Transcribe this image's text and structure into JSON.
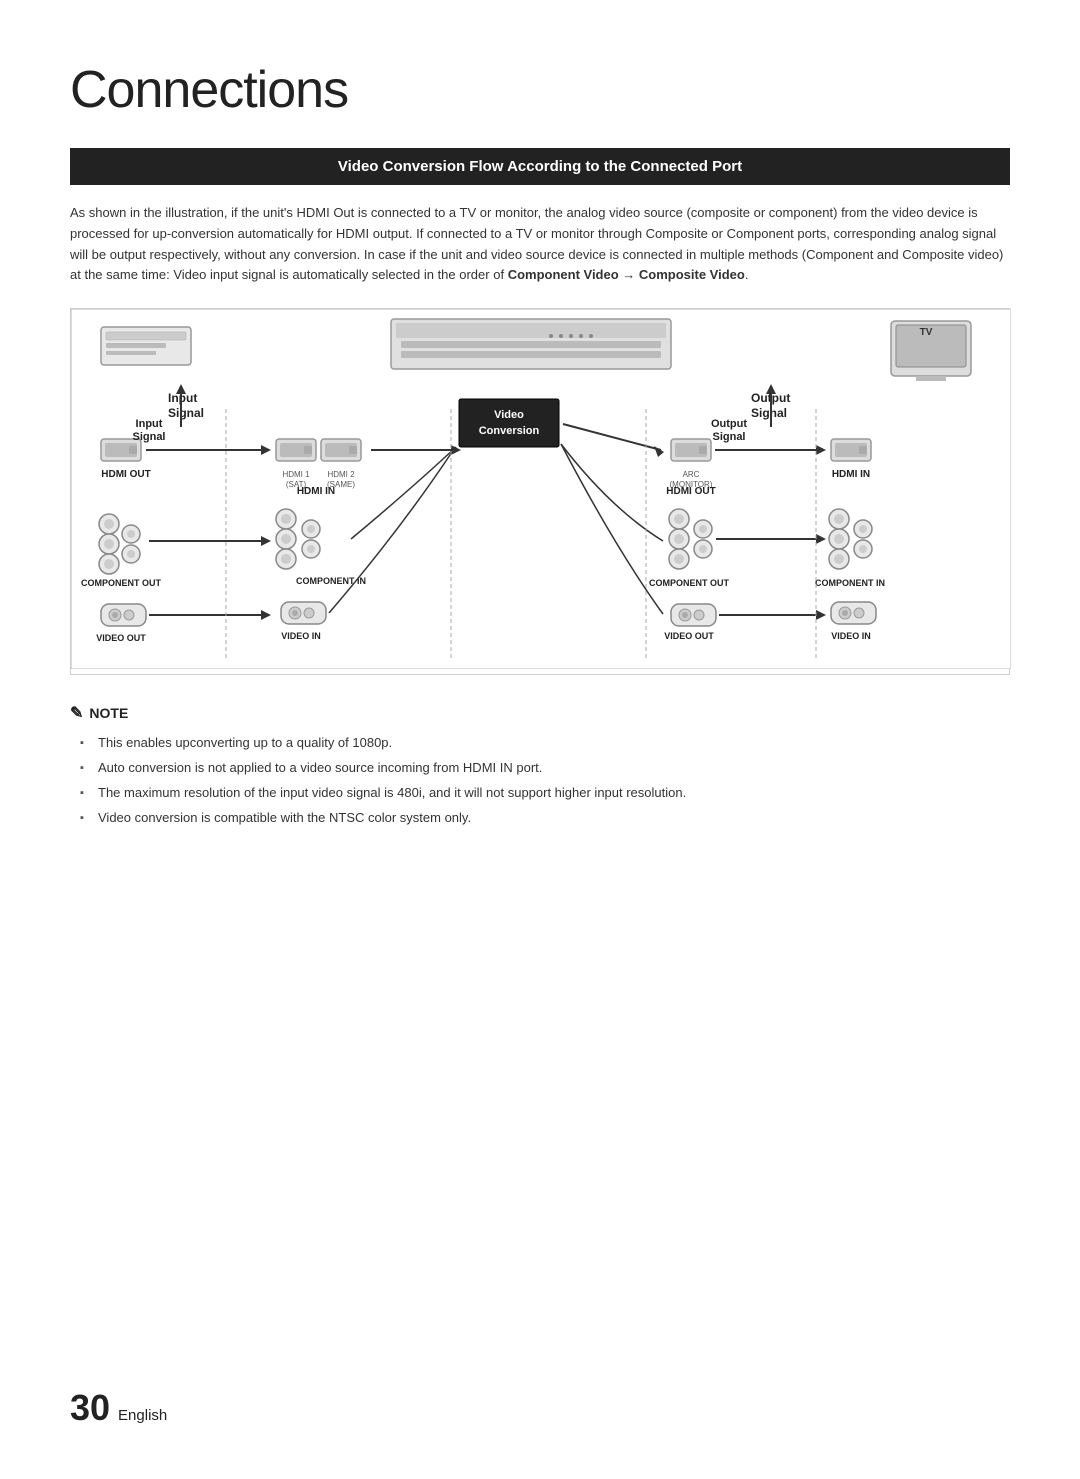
{
  "page": {
    "title": "Connections",
    "number": "30",
    "language": "English"
  },
  "section": {
    "header": "Video Conversion Flow According to the Connected Port"
  },
  "body_text": "As shown in the illustration, if the unit's HDMI Out is connected to a TV or monitor, the analog video source (composite or component) from the video device is processed for up-conversion automatically for HDMI output. If connected to a TV or monitor through Composite or Component ports, corresponding analog signal will be output respectively, without any conversion. In case if the unit and video source device is connected in multiple methods (Component and Composite video) at the same time: Video input signal is automatically selected in the order of",
  "body_text_bold": "Component Video → Composite Video",
  "body_text_end": ".",
  "diagram": {
    "input_label": "Input\nSignal",
    "output_label": "Output\nSignal",
    "conversion_label": "Video\nConversion",
    "left_device_labels": [
      "HDMI OUT",
      "COMPONENT OUT",
      "VIDEO OUT"
    ],
    "center_left_labels": [
      "HDMI IN",
      "COMPONENT IN",
      "VIDEO IN"
    ],
    "center_right_labels": [
      "HDMI OUT",
      "COMPONENT OUT",
      "VIDEO OUT"
    ],
    "right_labels": [
      "HDMI IN",
      "COMPONENT IN",
      "VIDEO IN"
    ]
  },
  "note": {
    "title": "NOTE",
    "items": [
      "This enables upconverting up to a quality of 1080p.",
      "Auto conversion is not applied to a video source incoming from HDMI IN port.",
      "The maximum resolution of the input video signal is 480i, and it will not support higher input resolution.",
      "Video conversion is compatible with the NTSC color system only."
    ]
  }
}
